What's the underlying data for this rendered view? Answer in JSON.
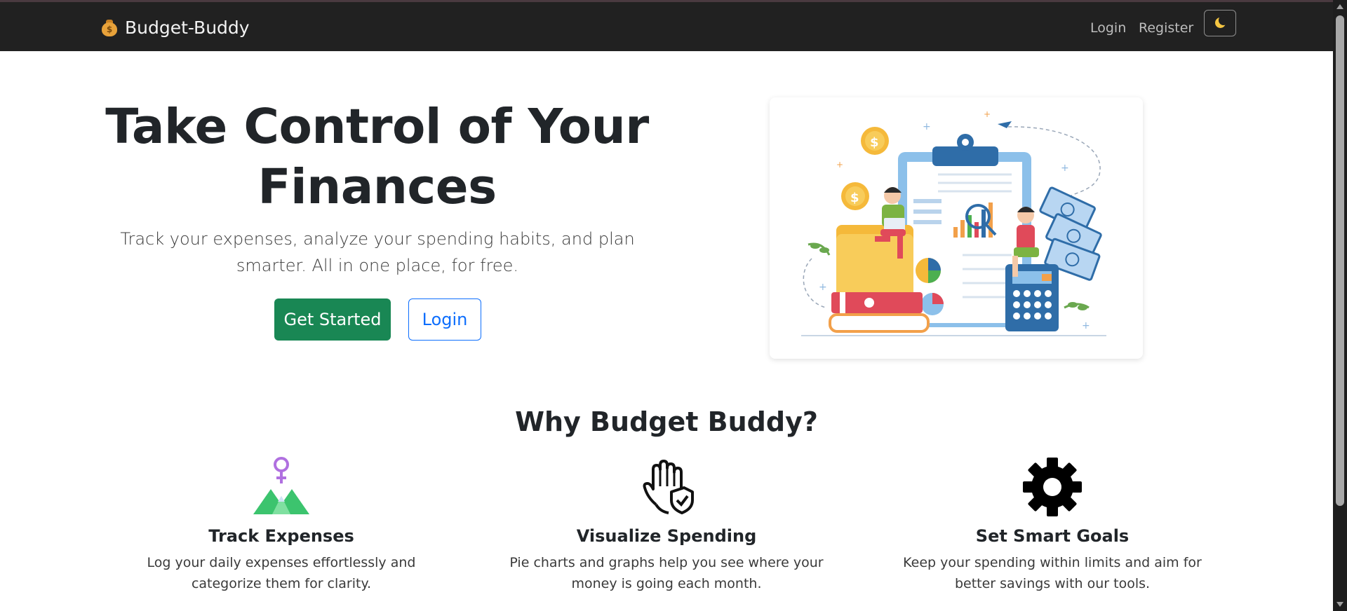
{
  "nav": {
    "brand": "Budget-Buddy",
    "brand_icon": "money-bag-icon",
    "login": "Login",
    "register": "Register",
    "theme_toggle_icon": "moon-icon"
  },
  "hero": {
    "title": "Take Control of Your Finances",
    "subtitle": "Track your expenses, analyze your spending habits, and plan smarter. All in one place, for free.",
    "primary_button": "Get Started",
    "secondary_button": "Login",
    "image": "finance-illustration"
  },
  "features": {
    "heading": "Why Budget Buddy?",
    "items": [
      {
        "icon": "mountain-pin-icon",
        "title": "Track Expenses",
        "text": "Log your daily expenses effortlessly and categorize them for clarity."
      },
      {
        "icon": "hand-shield-icon",
        "title": "Visualize Spending",
        "text": "Pie charts and graphs help you see where your money is going each month."
      },
      {
        "icon": "gear-icon",
        "title": "Set Smart Goals",
        "text": "Keep your spending within limits and aim for better savings with our tools."
      }
    ]
  },
  "colors": {
    "navbar": "#212121",
    "primary": "#198754",
    "link": "#0d6efd"
  }
}
